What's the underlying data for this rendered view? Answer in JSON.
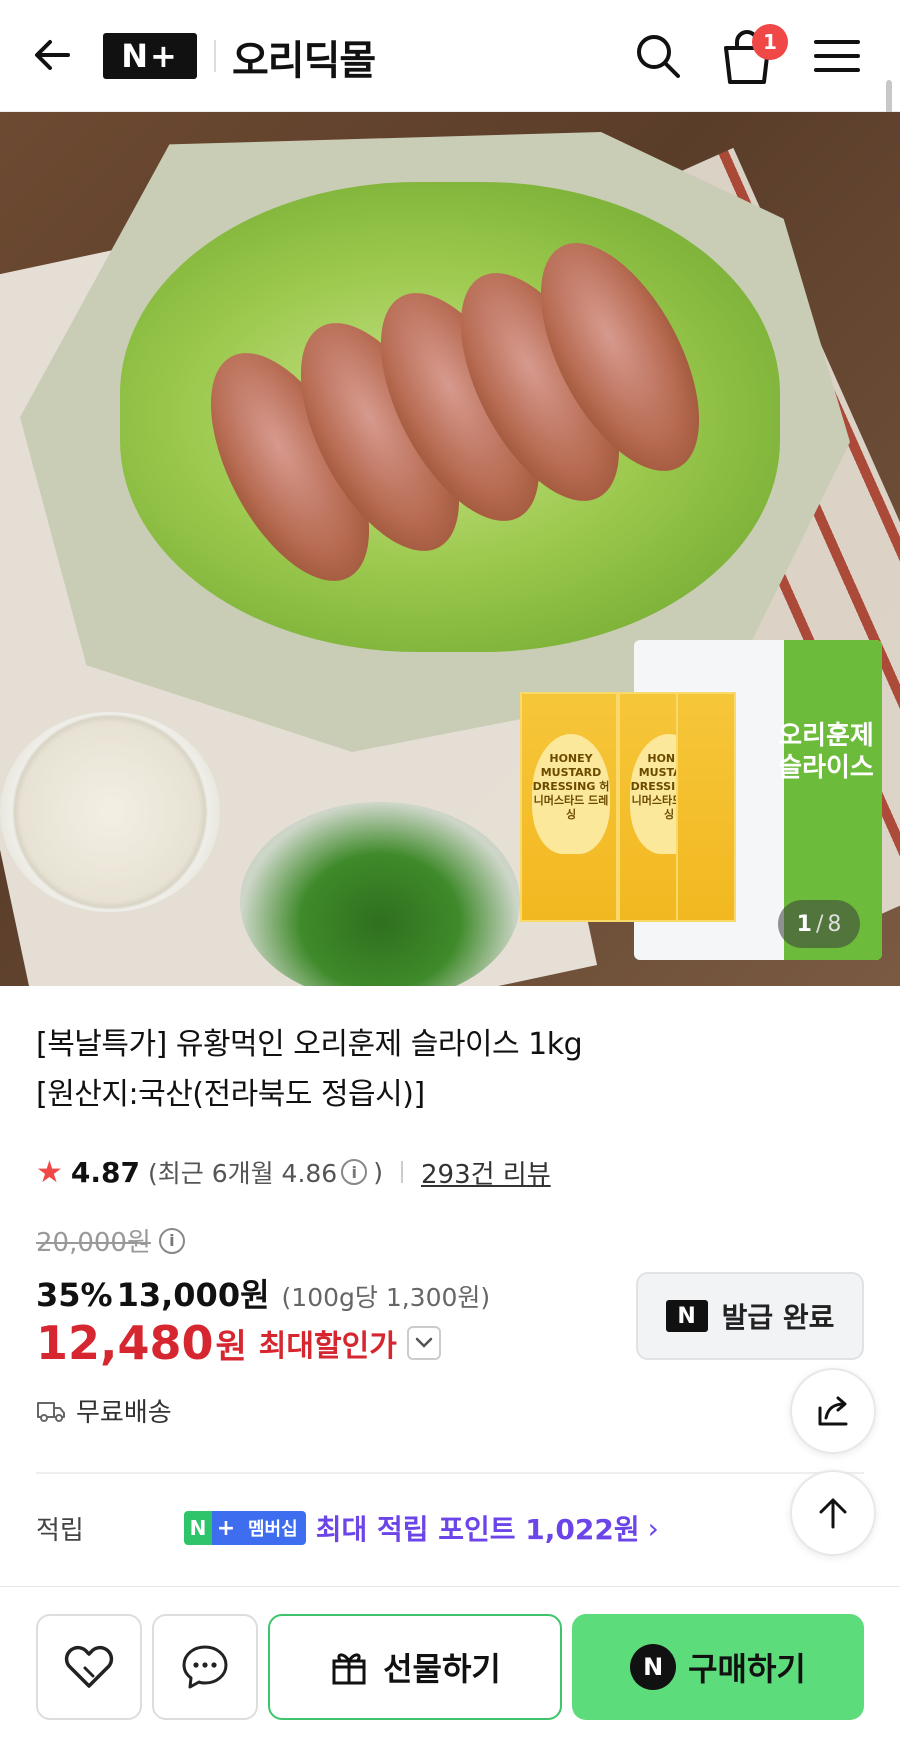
{
  "header": {
    "nplus_logo": "N+",
    "store_name": "오리딕몰",
    "cart_count": "1"
  },
  "gallery": {
    "current": "1",
    "separator": "/",
    "total": "8",
    "package_text": "오리훈제 슬라이스",
    "sachet_text": "HONEY MUSTARD DRESSING 허니머스타드 드레싱"
  },
  "product": {
    "title_line1": "[복날특가] 유황먹인 오리훈제 슬라이스 1kg",
    "title_line2": "[원산지:국산(전라북도 정읍시)]",
    "rating": "4.87",
    "recent_rating_prefix": "(최근 6개월 4.86",
    "recent_rating_suffix": ")",
    "review_count": "293건 리뷰",
    "original_price": "20,000원",
    "discount_rate": "35%",
    "sale_price": "13,000원",
    "unit_price": "(100g당 1,300원)",
    "max_price_value": "12,480",
    "max_price_currency": "원",
    "max_price_label": "최대할인가",
    "delivery": "무료배송"
  },
  "coupon": {
    "icon_letter": "N",
    "label": "발급 완료"
  },
  "points": {
    "label": "적립",
    "badge_n": "N",
    "badge_plus": "+",
    "badge_text": "멤버십",
    "text": "최대 적립 포인트 1,022원"
  },
  "bottom_bar": {
    "gift_label": "선물하기",
    "buy_icon": "N",
    "buy_label": "구매하기"
  },
  "colors": {
    "accent_red": "#d6262f",
    "membership_purple": "#6b45e8",
    "buy_green": "#5ddc7c",
    "cart_badge": "#f04747"
  },
  "icons": [
    "back-arrow-icon",
    "search-icon",
    "shopping-bag-icon",
    "menu-icon",
    "info-icon",
    "chevron-down-icon",
    "delivery-truck-icon",
    "share-icon",
    "arrow-up-icon",
    "chevron-right-icon",
    "heart-icon",
    "chat-icon",
    "gift-icon"
  ]
}
